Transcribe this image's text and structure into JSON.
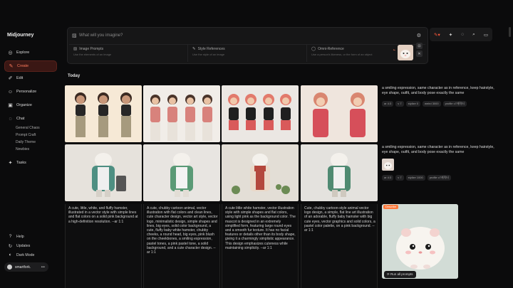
{
  "app": {
    "name": "Midjourney"
  },
  "sidebar": {
    "items": [
      {
        "label": "Explore",
        "icon": "compass-icon",
        "glyph": "◎"
      },
      {
        "label": "Create",
        "icon": "brush-icon",
        "glyph": "✎",
        "active": true
      },
      {
        "label": "Edit",
        "icon": "edit-icon",
        "glyph": "✐"
      },
      {
        "label": "Personalize",
        "icon": "person-icon",
        "glyph": "☺"
      },
      {
        "label": "Organize",
        "icon": "folder-icon",
        "glyph": "▣"
      },
      {
        "label": "Chat",
        "icon": "chat-icon",
        "glyph": "◌"
      },
      {
        "label": "Tasks",
        "icon": "tasks-icon",
        "glyph": "✦"
      }
    ],
    "chat_rooms": [
      "General Chaos",
      "Prompt Craft",
      "Daily Theme",
      "Newbies"
    ],
    "footer": [
      {
        "label": "Help",
        "icon": "help-icon",
        "glyph": "?"
      },
      {
        "label": "Updates",
        "icon": "updates-icon",
        "glyph": "↻"
      },
      {
        "label": "Dark Mode",
        "icon": "moon-icon",
        "glyph": "◐"
      }
    ],
    "user": {
      "name": "smartfork.",
      "menu": "•••"
    }
  },
  "prompt": {
    "placeholder": "What will you imagine?",
    "refs": [
      {
        "title": "Image Prompts",
        "desc": "Use the elements of an image",
        "icon": "image-icon"
      },
      {
        "title": "Style References",
        "desc": "Use the style of an image",
        "icon": "palette-icon"
      },
      {
        "title": "Omni-Reference",
        "desc": "Use a person's likeness, or the form of an object",
        "icon": "omni-icon"
      }
    ]
  },
  "gallery": {
    "section": "Today",
    "row1": {
      "prompt": "a smiling expression, same character as in reference, keep hairstyle, eye shape, outfit, and body pose exactly the same",
      "chips": [
        "ar 4:3",
        "v 7",
        "stylize 0",
        "weird 3000",
        "profile v7캐릭터"
      ]
    },
    "row2": {
      "prompt": "a smiling expression, same character as in reference, keep hairstyle, eye shape, outfit, and body pose exactly the same",
      "chips": [
        "ar 4:3",
        "v 7",
        "stylize 1000",
        "profile v7캐릭터"
      ]
    },
    "captions": [
      "A cute, little, white, and fluffy hamster, illustrated in a vector style with simple lines and flat colors on a solid pink background at a high-definition resolution. --ar 1:1",
      "A cute, chubby cartoon animal, vector illustration with flat colors and clean lines, cute character design, vector art style, vector logo, minimalistic design, simple shapes and lines, big eyes, solid color background, a cute, fluffy baby white hamster, chubby cheeks, a round head, big eyes, pink blush on the cheekbones, a smiling expression, pastel tones, a pink pastel tone, a solid background, and a cute character design. --ar 1:1",
      "A cute little white hamster, vector illustration style with simple shapes and flat colors, using light pink as the background color. The mascot is designed in an extremely simplified form, featuring large round eyes and a smooth fur texture. It has no facial features or details other than its body shape, giving it a charmingly simplistic appearance. This design emphasizes cuteness while maintaining simplicity. --ar 1:1",
      "Cute, chubby cartoon-style animal vector logo design, a simple, flat line art illustration of an adorable, fluffy baby hamster with big cute eyes, vector graphics and solid colors, a pastel color palette, on a pink background. --ar 1:1"
    ],
    "describe_badge": "Describe",
    "run_all": "Run all prompts"
  },
  "colors": {
    "accent": "#ff7a5c",
    "bg": "#0b0b0c",
    "panel": "#161617"
  }
}
